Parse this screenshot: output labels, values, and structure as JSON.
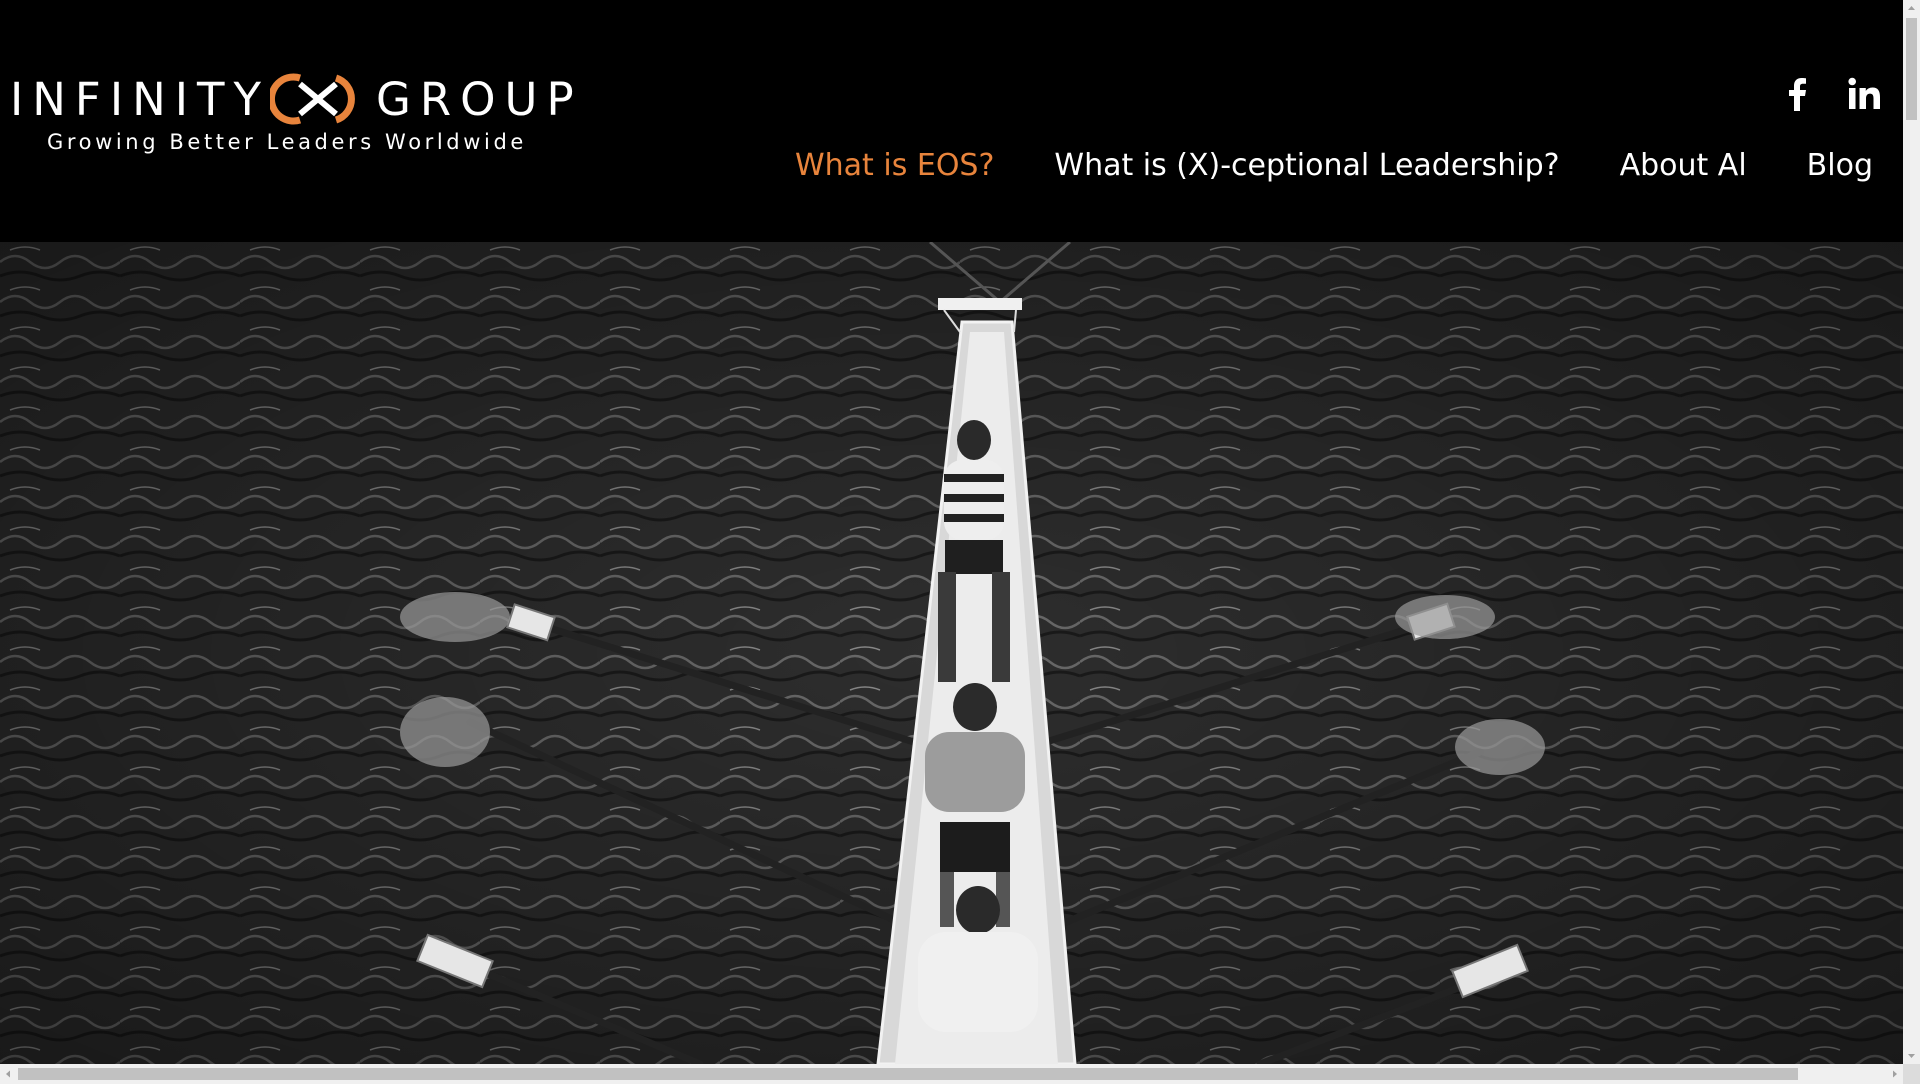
{
  "brand": {
    "name_left": "INFINITY",
    "name_right": "GROUP",
    "tagline": "Growing Better Leaders Worldwide",
    "accent_color": "#e8843c"
  },
  "social": {
    "icons": [
      "facebook-icon",
      "linkedin-icon"
    ]
  },
  "nav": {
    "items": [
      {
        "label": "What is EOS?",
        "active": true
      },
      {
        "label": "What is (X)-ceptional Leadership?",
        "active": false
      },
      {
        "label": "About Al",
        "active": false
      },
      {
        "label": "Blog",
        "active": false
      }
    ]
  },
  "hero": {
    "image": "rowing-boat-photo"
  }
}
